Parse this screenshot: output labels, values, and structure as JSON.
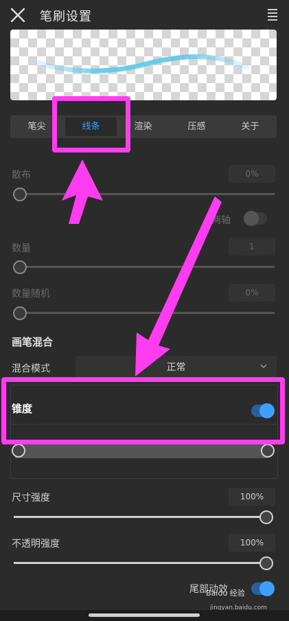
{
  "header": {
    "title": "笔刷设置"
  },
  "tabs": [
    "笔尖",
    "线条",
    "渲染",
    "压感",
    "关于"
  ],
  "active_tab": "线条",
  "settings": {
    "scatter": {
      "label": "散布",
      "value": "0%",
      "level": 0
    },
    "two_axis": {
      "label": "两轴",
      "on": false
    },
    "count": {
      "label": "数量",
      "value": "1",
      "level": 0
    },
    "count_random": {
      "label": "数量随机",
      "value": "0%",
      "level": 0
    }
  },
  "blend": {
    "section_title": "画笔混合",
    "mode_label": "混合模式",
    "mode_value": "正常"
  },
  "taper": {
    "label": "锥度",
    "on": true
  },
  "size_strength": {
    "label": "尺寸强度",
    "value": "100%",
    "level": 1
  },
  "opacity_strength": {
    "label": "不透明强度",
    "value": "100%",
    "level": 1
  },
  "tail_effect": {
    "label": "尾部动效",
    "on": true
  },
  "watermark": {
    "brand": "Baidu 经验",
    "url": "jingyan.baidu.com"
  },
  "colors": {
    "accent": "#3da0ff",
    "highlight": "#ff3df0",
    "background": "#2b2b2b"
  }
}
